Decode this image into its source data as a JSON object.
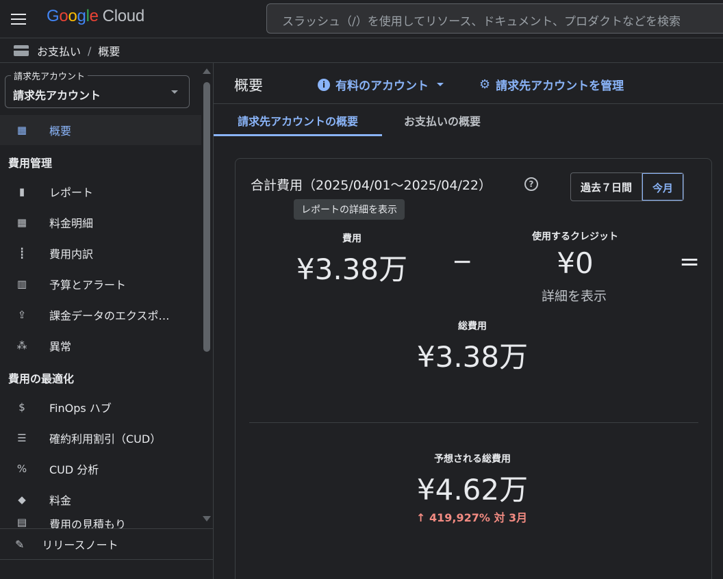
{
  "header": {
    "logo_google": "Google",
    "logo_cloud": "Cloud",
    "search_placeholder": "スラッシュ（/）を使用してリソース、ドキュメント、プロダクトなどを検索"
  },
  "breadcrumb": {
    "parent": "お支払い",
    "separator": "/",
    "current": "概要"
  },
  "sidebar": {
    "account_legend": "請求先アカウント",
    "account_value": "請求先アカウント",
    "active_item": "概要",
    "section_cost_management": "費用管理",
    "cost_items": [
      "レポート",
      "料金明細",
      "費用内訳",
      "予算とアラート",
      "課金データのエクスポ…",
      "異常"
    ],
    "section_optimization": "費用の最適化",
    "opt_items": [
      "FinOps ハブ",
      "確約利用割引（CUD）",
      "CUD 分析",
      "料金",
      "費用の見積もり"
    ],
    "release_notes": "リリースノート"
  },
  "main": {
    "title": "概要",
    "paid_account": "有料のアカウント",
    "manage_accounts": "請求先アカウントを管理",
    "tabs": [
      "請求先アカウントの概要",
      "お支払いの概要"
    ],
    "card": {
      "title": "合計費用（2025/04/01〜2025/04/22）",
      "range_past7": "過去７日間",
      "range_month": "今月",
      "tooltip": "レポートの詳細を表示",
      "cost_label": "費用",
      "cost_value": "¥3.38万",
      "minus": "−",
      "credits_label": "使用するクレジット",
      "credits_value": "¥0",
      "equals": "=",
      "show_details": "詳細を表示",
      "total_label": "総費用",
      "total_value": "¥3.38万",
      "forecast_label": "予想される総費用",
      "forecast_value": "¥4.62万",
      "forecast_delta": "↑ 419,927% 対 3月"
    }
  },
  "colors": {
    "accent": "#8ab4f8",
    "negative": "#f28b82",
    "background": "#202124"
  }
}
